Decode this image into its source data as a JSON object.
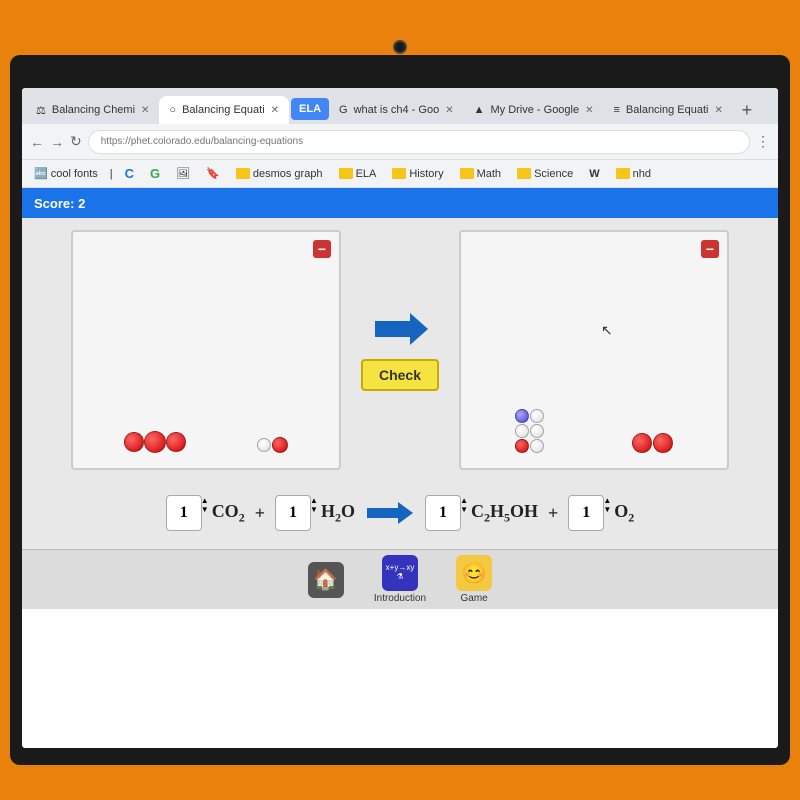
{
  "browser": {
    "tabs": [
      {
        "label": "Balancing Chemi",
        "active": false,
        "id": "tab1"
      },
      {
        "label": "Balancing Equati",
        "active": true,
        "id": "tab2"
      },
      {
        "label": "what is ch4 - Goo",
        "active": false,
        "id": "tab3"
      },
      {
        "label": "My Drive - Google",
        "active": false,
        "id": "tab4"
      },
      {
        "label": "Balancing Equati",
        "active": false,
        "id": "tab5"
      }
    ],
    "ela_label": "ELA",
    "address": "https://phet.colorado.edu/balancing-equations",
    "bookmarks": [
      "cool fonts",
      "desmos graph",
      "ELA",
      "History",
      "Math",
      "Science",
      "nhd"
    ]
  },
  "score_bar": {
    "score_label": "Score: 2"
  },
  "equation": {
    "left": {
      "coeff1": "1",
      "formula1": "CO",
      "sub1": "2",
      "plus": "+",
      "coeff2": "1",
      "formula2": "H",
      "sub2": "2",
      "formula2b": "O"
    },
    "arrow": "→",
    "right": {
      "coeff3": "1",
      "formula3": "C",
      "sub3": "2",
      "formula3b": "H",
      "sub4": "5",
      "formula3c": "OH",
      "plus": "+",
      "coeff4": "1",
      "formula4": "O",
      "sub5": "2"
    }
  },
  "check_button": "Check",
  "minus_button": "−",
  "taskbar": {
    "home_label": "",
    "intro_label": "Introduction",
    "game_label": "Game"
  }
}
